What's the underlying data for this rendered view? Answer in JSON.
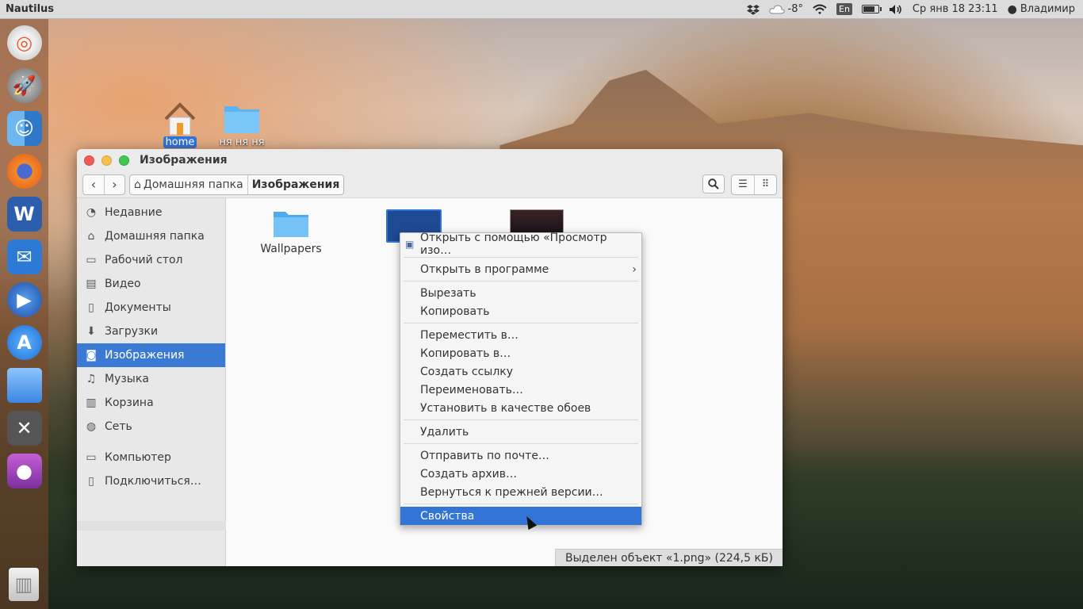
{
  "top_panel": {
    "app_name": "Nautilus",
    "temperature": "-8°",
    "keyboard_layout": "En",
    "datetime": "Ср янв 18 23:11",
    "user": "Владимир"
  },
  "launcher": {
    "items": [
      "ubuntu-logo-icon",
      "rocket-launcher-icon",
      "finder-icon",
      "firefox-icon",
      "word-icon",
      "mail-bird-icon",
      "media-player-icon",
      "app-store-icon",
      "desktop-icon",
      "system-tools-icon",
      "screen-recorder-icon"
    ],
    "trash": "trash-icon"
  },
  "desktop": {
    "icons": [
      {
        "label": "home",
        "selected": true,
        "icon": "home-icon"
      },
      {
        "label": "ня ня ня",
        "selected": false,
        "icon": "folder-icon"
      }
    ]
  },
  "window": {
    "title": "Изображения",
    "breadcrumb": [
      "Домашняя папка",
      "Изображения"
    ],
    "sidebar": {
      "places": [
        {
          "label": "Недавние",
          "icon": "recent-icon"
        },
        {
          "label": "Домашняя папка",
          "icon": "home-icon"
        },
        {
          "label": "Рабочий стол",
          "icon": "desktop-icon"
        },
        {
          "label": "Видео",
          "icon": "video-icon"
        },
        {
          "label": "Документы",
          "icon": "documents-icon"
        },
        {
          "label": "Загрузки",
          "icon": "downloads-icon"
        },
        {
          "label": "Изображения",
          "icon": "pictures-icon",
          "active": true
        },
        {
          "label": "Музыка",
          "icon": "music-icon"
        },
        {
          "label": "Корзина",
          "icon": "trash-icon"
        },
        {
          "label": "Сеть",
          "icon": "network-icon"
        }
      ],
      "devices": [
        {
          "label": "Компьютер",
          "icon": "computer-icon"
        },
        {
          "label": "Подключиться…",
          "icon": "connect-icon"
        }
      ]
    },
    "files": [
      {
        "name": "Wallpapers",
        "type": "folder"
      },
      {
        "name": "",
        "type": "image",
        "selected": true
      },
      {
        "name": "",
        "type": "image"
      }
    ],
    "status": "Выделен объект «1.png» (224,5 кБ)"
  },
  "context_menu": {
    "groups": [
      [
        {
          "label": "Открыть с помощью «Просмотр изо…",
          "icon": "image-viewer-icon"
        },
        {
          "label": "Открыть в программе",
          "submenu": true
        }
      ],
      [
        {
          "label": "Вырезать"
        },
        {
          "label": "Копировать"
        }
      ],
      [
        {
          "label": "Переместить в…"
        },
        {
          "label": "Копировать в…"
        },
        {
          "label": "Создать ссылку"
        },
        {
          "label": "Переименовать…"
        },
        {
          "label": "Установить в качестве обоев"
        }
      ],
      [
        {
          "label": "Удалить"
        }
      ],
      [
        {
          "label": "Отправить по почте…"
        },
        {
          "label": "Создать архив…"
        },
        {
          "label": "Вернуться к прежней версии…"
        }
      ],
      [
        {
          "label": "Свойства",
          "highlighted": true
        }
      ]
    ]
  }
}
